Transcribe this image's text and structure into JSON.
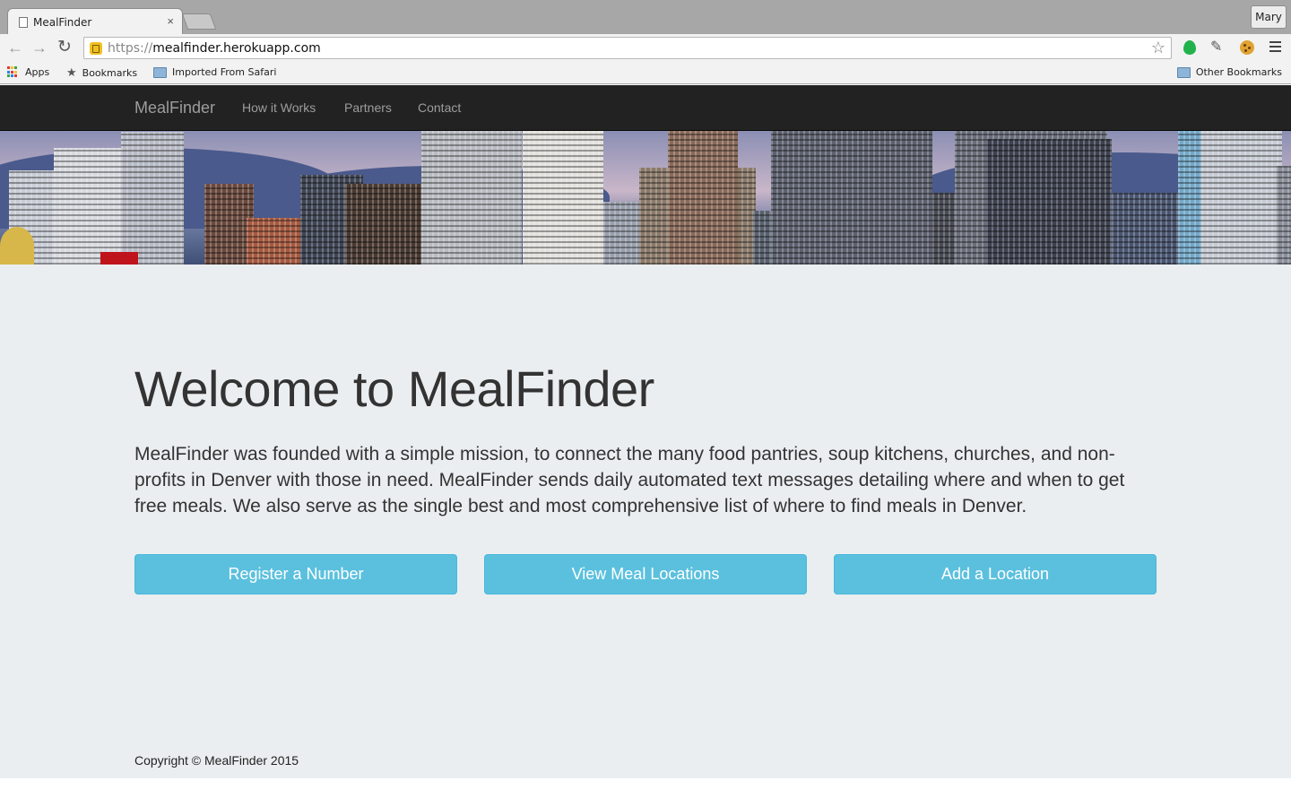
{
  "browser": {
    "tab_title": "MealFinder",
    "tab_close": "×",
    "profile_name": "Mary",
    "url_scheme": "https://",
    "url_host": "mealfinder.herokuapp.com",
    "bookmarks": {
      "apps": "Apps",
      "bookmarks": "Bookmarks",
      "imported": "Imported From Safari",
      "other": "Other Bookmarks"
    }
  },
  "navbar": {
    "brand": "MealFinder",
    "links": [
      "How it Works",
      "Partners",
      "Contact"
    ]
  },
  "hero": {
    "title": "Welcome to MealFinder",
    "lead": "MealFinder was founded with a simple mission, to connect the many food pantries, soup kitchens, churches, and non-profits in Denver with those in need. MealFinder sends daily automated text messages detailing where and when to get free meals. We also serve as the single best and most comprehensive list of where to find meals in Denver."
  },
  "actions": {
    "register": "Register a Number",
    "view": "View Meal Locations",
    "add": "Add a Location"
  },
  "footer": {
    "copyright": "Copyright © MealFinder 2015"
  },
  "colors": {
    "navbar_bg": "#222222",
    "button_info": "#5bc0de",
    "page_bg": "#ebeef0"
  }
}
